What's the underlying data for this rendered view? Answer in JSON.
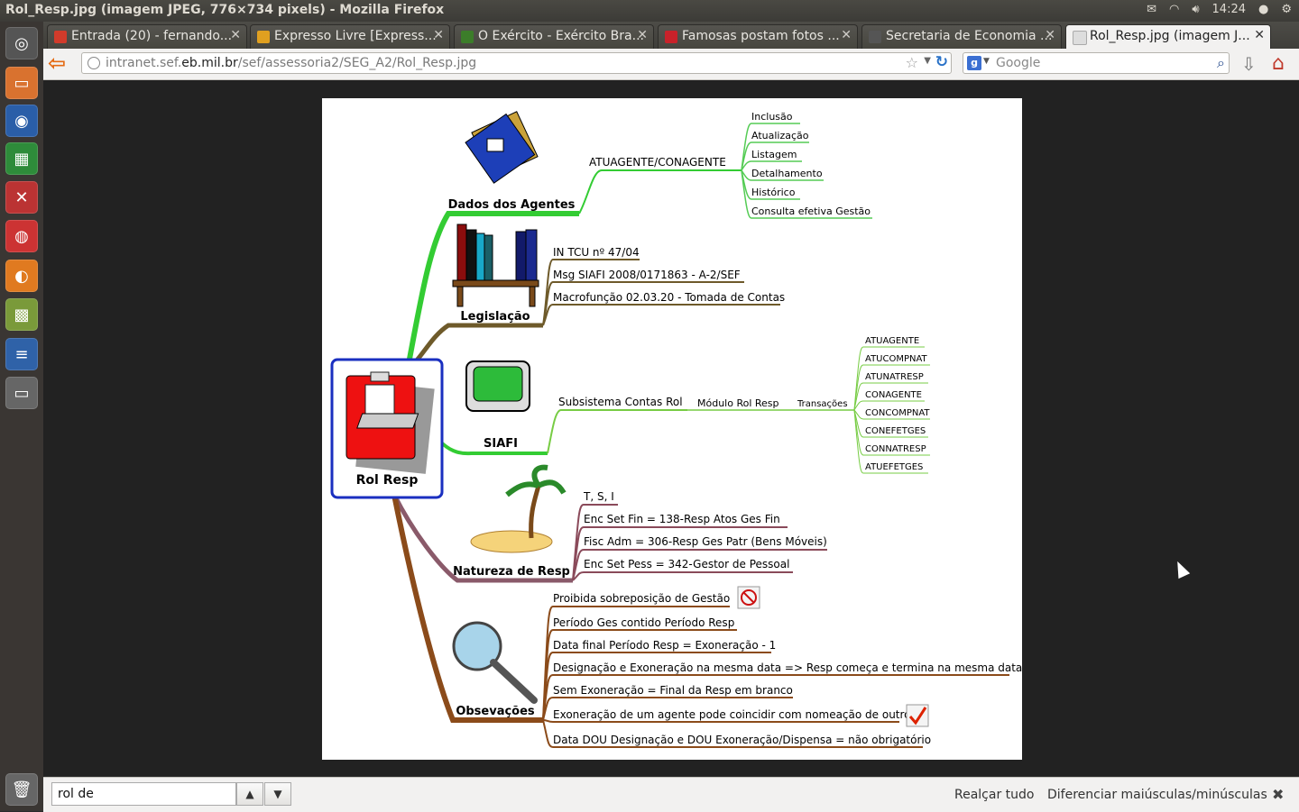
{
  "window": {
    "title": "Rol_Resp.jpg (imagem JPEG, 776×734 pixels) - Mozilla Firefox",
    "clock": "14:24"
  },
  "tabs": [
    {
      "label": "Entrada (20) - fernando...",
      "fav_color": "#d23b2b"
    },
    {
      "label": "Expresso Livre [Express...",
      "fav_color": "#e0a020"
    },
    {
      "label": "O Exército - Exército Bra...",
      "fav_color": "#3c7d2a"
    },
    {
      "label": "Famosas postam fotos ...",
      "fav_color": "#c8222a"
    },
    {
      "label": "Secretaria de Economia ...",
      "fav_color": "#555555"
    },
    {
      "label": "Rol_Resp.jpg (imagem J...",
      "fav_color": "#dddddd"
    }
  ],
  "nav": {
    "url_prefix": "intranet.sef.",
    "url_host": "eb.mil.br",
    "url_path": "/sef/assessoria2/SEG_A2/Rol_Resp.jpg",
    "search_placeholder": "Google",
    "search_engine_icon": "g-icon"
  },
  "findbar": {
    "query": "rol de",
    "highlight_all": "Realçar tudo",
    "match_case": "Diferenciar maiúsculas/minúsculas"
  },
  "mindmap": {
    "root": "Rol Resp",
    "branches": {
      "agentes": {
        "title": "Dados dos Agentes",
        "sub": "ATUAGENTE/CONAGENTE",
        "items": [
          "Inclusão",
          "Atualização",
          "Listagem",
          "Detalhamento",
          "Histórico",
          "Consulta efetiva Gestão"
        ]
      },
      "legislacao": {
        "title": "Legislação",
        "items": [
          "IN TCU nº 47/04",
          "Msg SIAFI 2008/0171863 - A-2/SEF",
          "Macrofunção 02.03.20 - Tomada de Contas"
        ]
      },
      "siafi": {
        "title": "SIAFI",
        "sub1": "Subsistema Contas Rol",
        "sub2": "Módulo Rol Resp",
        "sub3": "Transações",
        "items": [
          "ATUAGENTE",
          "ATUCOMPNAT",
          "ATUNATRESP",
          "CONAGENTE",
          "CONCOMPNAT",
          "CONEFETGES",
          "CONNATRESP",
          "ATUEFETGES"
        ]
      },
      "natureza": {
        "title": "Natureza de Resp",
        "items": [
          "T, S, I",
          "Enc Set Fin = 138-Resp Atos Ges Fin",
          "Fisc Adm = 306-Resp Ges Patr (Bens Móveis)",
          "Enc Set Pess = 342-Gestor de Pessoal"
        ]
      },
      "observacoes": {
        "title": "Obsevações",
        "items": [
          "Proibida sobreposição de Gestão",
          "Período Ges contido Período Resp",
          "Data final Período Resp = Exoneração - 1",
          "Designação e Exoneração na mesma data => Resp começa e termina na mesma data",
          "Sem Exoneração = Final da Resp em branco",
          "Exoneração de um agente pode coincidir com nomeação de outro",
          "Data DOU Designação e DOU Exoneração/Dispensa = não obrigatório"
        ]
      }
    }
  }
}
